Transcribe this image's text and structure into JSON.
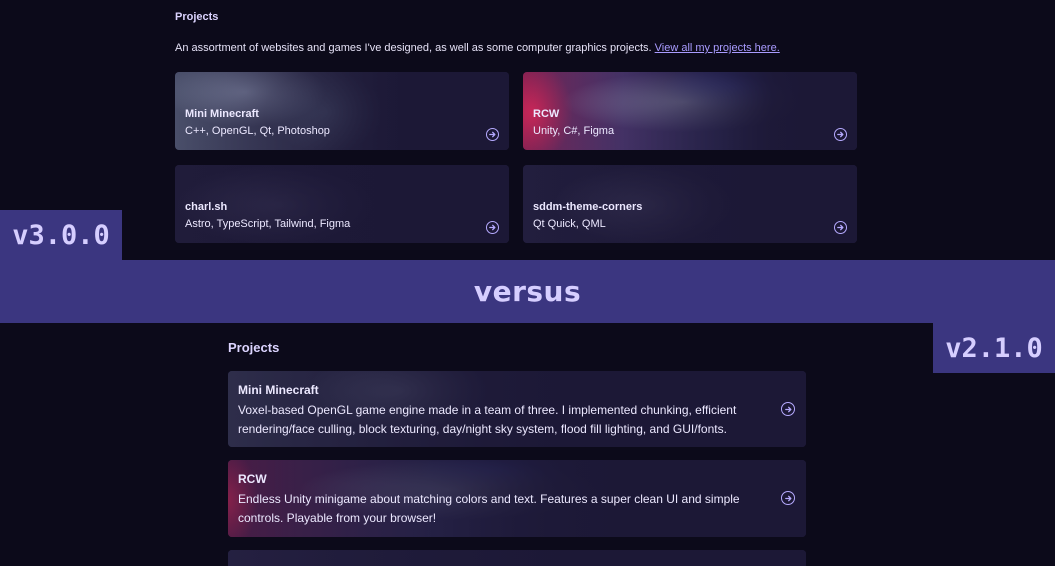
{
  "v3": {
    "tag": "v3.0.0",
    "section_title": "Projects",
    "description": "An assortment of websites and games I've designed, as well as some computer graphics projects.",
    "link_text": "View all my projects here.",
    "cards": [
      {
        "name": "Mini Minecraft",
        "tech": "C++, OpenGL, Qt, Photoshop"
      },
      {
        "name": "RCW",
        "tech": "Unity, C#, Figma"
      },
      {
        "name": "charl.sh",
        "tech": "Astro, TypeScript, Tailwind, Figma"
      },
      {
        "name": "sddm-theme-corners",
        "tech": "Qt Quick, QML"
      }
    ]
  },
  "versus_label": "versus",
  "v2": {
    "tag": "v2.1.0",
    "section_title": "Projects",
    "cards": [
      {
        "name": "Mini Minecraft",
        "description": "Voxel-based OpenGL game engine made in a team of three. I implemented chunking, efficient rendering/face culling, block texturing, day/night sky system, flood fill lighting, and GUI/fonts."
      },
      {
        "name": "RCW",
        "description": "Endless Unity minigame about matching colors and text. Features a super clean UI and simple controls. Playable from your browser!"
      }
    ]
  },
  "colors": {
    "background": "#0c0a1a",
    "card": "#1c1836",
    "accent_bar": "#3b3680",
    "accent_text": "#d6ceff",
    "link": "#a99bff"
  },
  "icons": {
    "card_arrow": "arrow-circle-right-icon"
  }
}
